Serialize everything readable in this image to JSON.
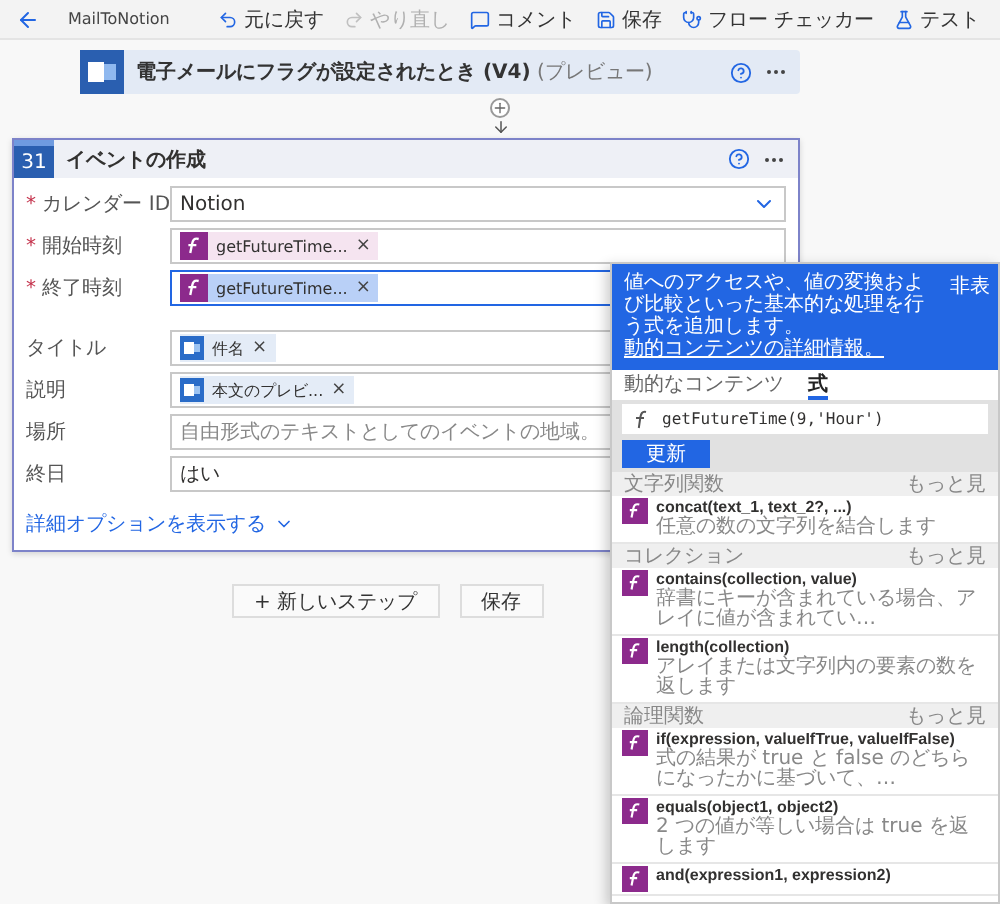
{
  "toolbar": {
    "flow_name": "MailToNotion",
    "actions": [
      {
        "kind": "undo",
        "label": "元に戻す",
        "disabled": false
      },
      {
        "kind": "redo",
        "label": "やり直し",
        "disabled": true
      },
      {
        "kind": "comment",
        "label": "コメント",
        "disabled": false
      },
      {
        "kind": "save",
        "label": "保存",
        "disabled": false
      },
      {
        "kind": "checker",
        "label": "フロー チェッカー",
        "disabled": false
      },
      {
        "kind": "test",
        "label": "テスト",
        "disabled": false
      }
    ]
  },
  "trigger": {
    "title": "**電子メールにフラグが設定されたとき (V4)** (プレビュー)"
  },
  "event_card": {
    "icon_text": "31",
    "title": "イベントの作成",
    "fields": [
      {
        "label": "カレンダー ID",
        "marker": "*",
        "focused": false,
        "kind": "dropdown",
        "value": "Notion"
      },
      {
        "label": "開始時刻",
        "marker": "*",
        "focused": false,
        "kind": "tokens",
        "tokens": [
          {
            "kind": "expression",
            "text": "getFutureTime...",
            "remove": "×",
            "selected": false
          }
        ]
      },
      {
        "label": "終了時刻",
        "marker": "*",
        "focused": true,
        "kind": "tokens",
        "tokens": [
          {
            "kind": "expression",
            "text": "getFutureTime...",
            "remove": "×",
            "selected": true
          }
        ]
      },
      {
        "label": "タイトル",
        "focused": false,
        "kind": "tokens",
        "tokens": [
          {
            "kind": "mail",
            "text": "件名",
            "remove": "×",
            "selected": false
          }
        ]
      },
      {
        "label": "説明",
        "focused": false,
        "kind": "tokens",
        "tokens": [
          {
            "kind": "mail",
            "text": "本文のプレビ...",
            "remove": "×",
            "selected": false
          }
        ]
      },
      {
        "label": "場所",
        "focused": false,
        "kind": "text",
        "placeholder": "自由形式のテキストとしてのイベントの地域。"
      },
      {
        "label": "終日",
        "focused": false,
        "kind": "text",
        "value": "はい"
      }
    ],
    "more_options": "詳細オプションを表示する"
  },
  "buttons": [
    "+ 新しいステップ",
    "保存"
  ],
  "panel": {
    "description": "値へのアクセスや、値の変換および比較といった基本的な処理を行う式を追加します。",
    "link": "動的コンテンツの詳細情報。",
    "hide": "非表",
    "tabs": [
      {
        "label": "動的なコンテンツ",
        "selected": false
      },
      {
        "label": "式",
        "selected": true
      }
    ],
    "expression": "getFutureTime(9,'Hour')",
    "update_button": "更新",
    "sections": [
      {
        "title": "文字列関数",
        "more": "もっと見",
        "functions": [
          {
            "name": "concat(text_1, text_2?, ...)",
            "description": "任意の数の文字列を結合します"
          }
        ]
      },
      {
        "title": "コレクション",
        "more": "もっと見",
        "functions": [
          {
            "name": "contains(collection, value)",
            "description": "辞書にキーが含まれている場合、アレイに値が含まれてい…"
          },
          {
            "name": "length(collection)",
            "description": "アレイまたは文字列内の要素の数を返します"
          }
        ]
      },
      {
        "title": "論理関数",
        "more": "もっと見",
        "functions": [
          {
            "name": "if(expression, valueIfTrue, valueIfFalse)",
            "description": "式の結果が true と false のどちらになったかに基づいて、…"
          },
          {
            "name": "equals(object1, object2)",
            "description": "2 つの値が等しい場合は true を返します"
          },
          {
            "name": "and(expression1, expression2)"
          }
        ]
      }
    ]
  }
}
